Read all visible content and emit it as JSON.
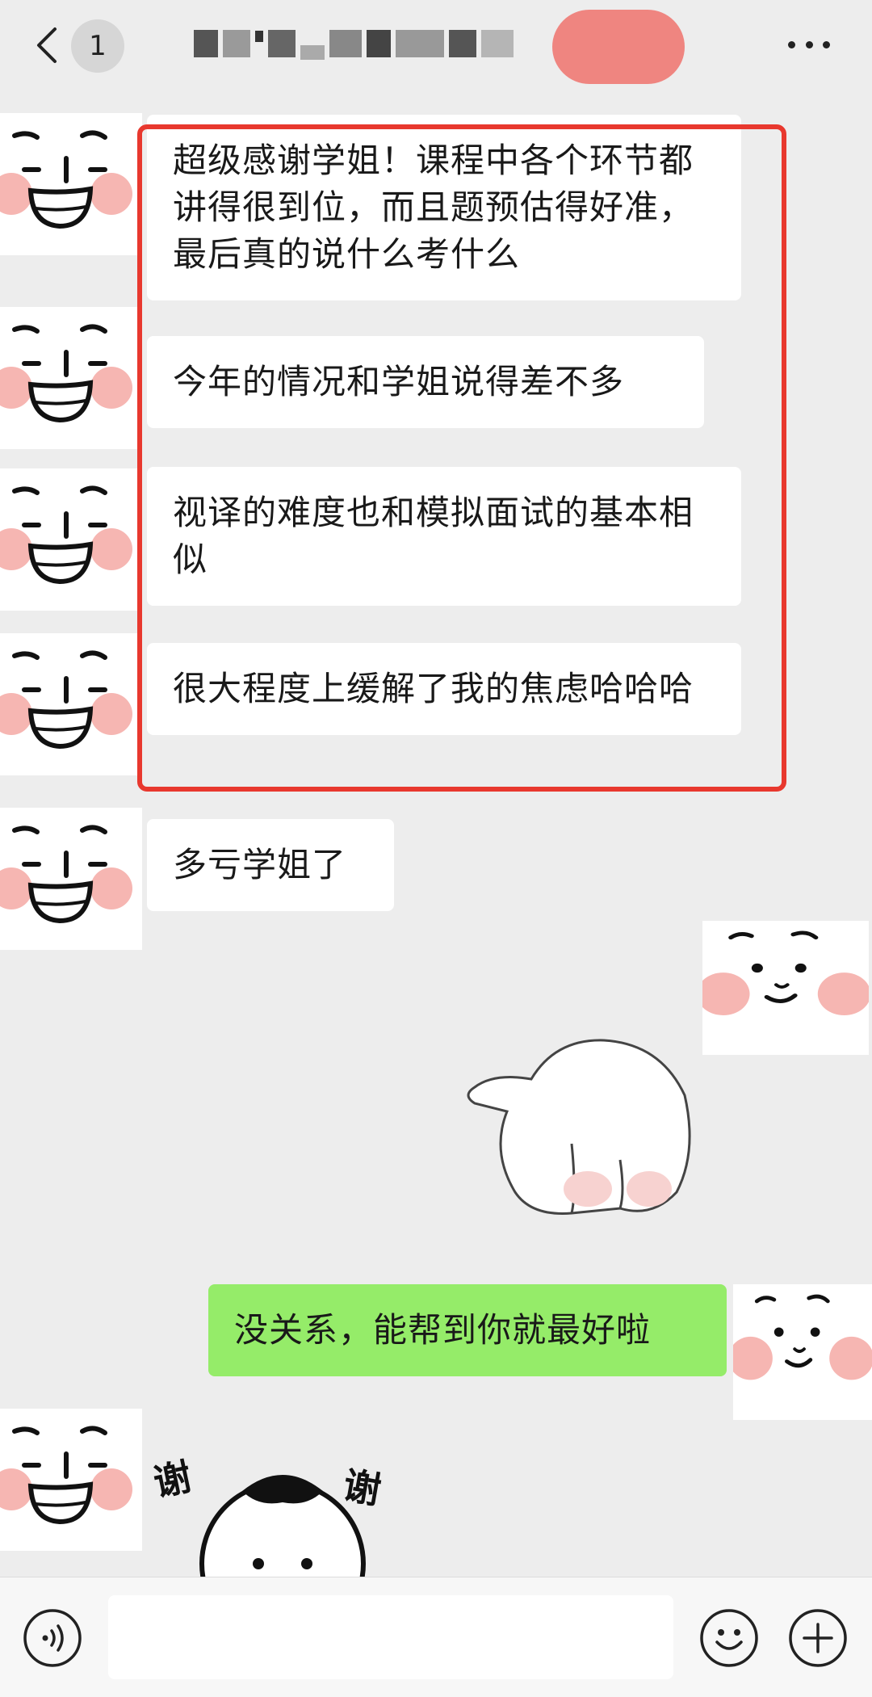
{
  "header": {
    "unread_count": "1",
    "back_icon": "chevron-left-icon",
    "more_icon": "more-horizontal-icon"
  },
  "messages": [
    {
      "side": "left",
      "text": "超级感谢学姐！课程中各个环节都讲得很到位，而且题预估得好准，最后真的说什么考什么"
    },
    {
      "side": "left",
      "text": "今年的情况和学姐说得差不多"
    },
    {
      "side": "left",
      "text": "视译的难度也和模拟面试的基本相似"
    },
    {
      "side": "left",
      "text": "很大程度上缓解了我的焦虑哈哈哈"
    },
    {
      "side": "left",
      "text": "多亏学姐了"
    },
    {
      "side": "right",
      "sticker": "bear-hiding-sticker"
    },
    {
      "side": "right",
      "text": "没关系，能帮到你就最好啦"
    },
    {
      "side": "left",
      "sticker": "thank-you-sticker",
      "sticker_text": "谢谢"
    }
  ],
  "colors": {
    "background": "#ededed",
    "incoming_bubble": "#ffffff",
    "outgoing_bubble": "#95ec69",
    "highlight_border": "#e8382e",
    "name_redaction": "#ef8580"
  },
  "input_bar": {
    "voice_icon": "voice-icon",
    "emoji_icon": "emoji-icon",
    "plus_icon": "plus-icon",
    "input_value": ""
  }
}
